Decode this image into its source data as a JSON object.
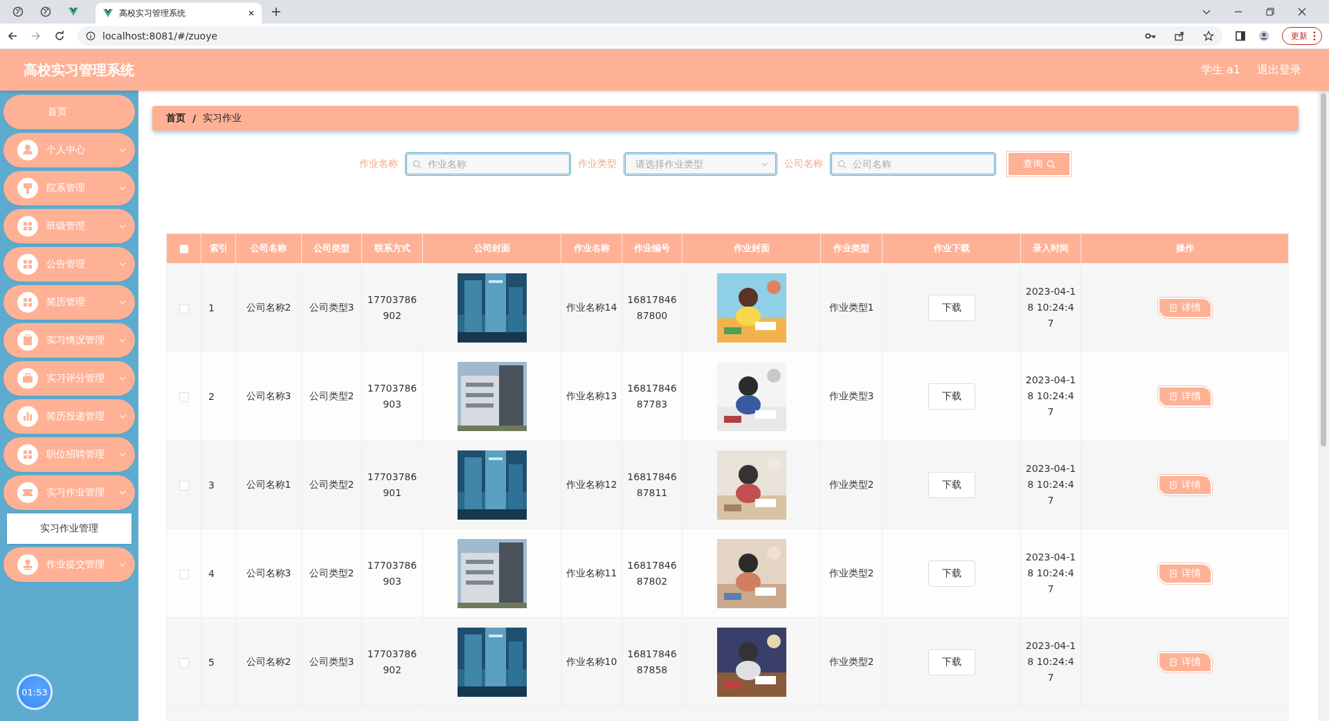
{
  "browser": {
    "tab_title": "高校实习管理系统",
    "url": "localhost:8081/#/zuoye",
    "update_button": "更新"
  },
  "header": {
    "title": "高校实习管理系统",
    "user": "学生 a1",
    "logout": "退出登录"
  },
  "sidebar": {
    "items": [
      {
        "label": "首页",
        "kind": "link"
      },
      {
        "label": "个人中心",
        "kind": "menu",
        "expanded": false
      },
      {
        "label": "院系管理",
        "kind": "menu",
        "expanded": false
      },
      {
        "label": "班级管理",
        "kind": "menu",
        "expanded": false
      },
      {
        "label": "公告管理",
        "kind": "menu",
        "expanded": false
      },
      {
        "label": "简历管理",
        "kind": "menu",
        "expanded": false
      },
      {
        "label": "实习情况管理",
        "kind": "menu",
        "expanded": false
      },
      {
        "label": "实习评分管理",
        "kind": "menu",
        "expanded": false
      },
      {
        "label": "简历投递管理",
        "kind": "menu",
        "expanded": false
      },
      {
        "label": "职位招聘管理",
        "kind": "menu",
        "expanded": false
      },
      {
        "label": "实习作业管理",
        "kind": "menu",
        "expanded": true,
        "children": [
          {
            "label": "实习作业管理",
            "selected": true
          }
        ]
      },
      {
        "label": "作业提交管理",
        "kind": "menu",
        "expanded": false
      }
    ],
    "timer": "01:53"
  },
  "breadcrumb": {
    "separator": "/",
    "items": [
      "首页",
      "实习作业"
    ]
  },
  "search": {
    "fields": [
      {
        "label": "作业名称",
        "kind": "text",
        "placeholder": "作业名称"
      },
      {
        "label": "作业类型",
        "kind": "select",
        "placeholder": "请选择作业类型"
      },
      {
        "label": "公司名称",
        "kind": "text",
        "placeholder": "公司名称"
      }
    ],
    "button": "查询"
  },
  "table": {
    "select_all_checked": false,
    "columns": [
      "索引",
      "公司名称",
      "公司类型",
      "联系方式",
      "公司封面",
      "作业名称",
      "作业编号",
      "作业封面",
      "作业类型",
      "作业下载",
      "录入时间",
      "操作"
    ],
    "rows": [
      {
        "checked": false,
        "index": "1",
        "company": "公司名称2",
        "company_type": "公司类型3",
        "phone": "17703786902",
        "task_name": "作业名称14",
        "task_no": "1681784687800",
        "task_type": "作业类型1",
        "download": "下载",
        "time": "2023-04-18 10:24:47",
        "action": "详情"
      },
      {
        "checked": false,
        "index": "2",
        "company": "公司名称3",
        "company_type": "公司类型2",
        "phone": "17703786903",
        "task_name": "作业名称13",
        "task_no": "1681784687783",
        "task_type": "作业类型3",
        "download": "下载",
        "time": "2023-04-18 10:24:47",
        "action": "详情"
      },
      {
        "checked": false,
        "index": "3",
        "company": "公司名称1",
        "company_type": "公司类型2",
        "phone": "17703786901",
        "task_name": "作业名称12",
        "task_no": "1681784687811",
        "task_type": "作业类型2",
        "download": "下载",
        "time": "2023-04-18 10:24:47",
        "action": "详情"
      },
      {
        "checked": false,
        "index": "4",
        "company": "公司名称3",
        "company_type": "公司类型2",
        "phone": "17703786903",
        "task_name": "作业名称11",
        "task_no": "1681784687802",
        "task_type": "作业类型2",
        "download": "下载",
        "time": "2023-04-18 10:24:47",
        "action": "详情"
      },
      {
        "checked": false,
        "index": "5",
        "company": "公司名称2",
        "company_type": "公司类型3",
        "phone": "17703786902",
        "task_name": "作业名称10",
        "task_no": "1681784687858",
        "task_type": "作业类型2",
        "download": "下载",
        "time": "2023-04-18 10:24:47",
        "action": "详情"
      }
    ]
  }
}
